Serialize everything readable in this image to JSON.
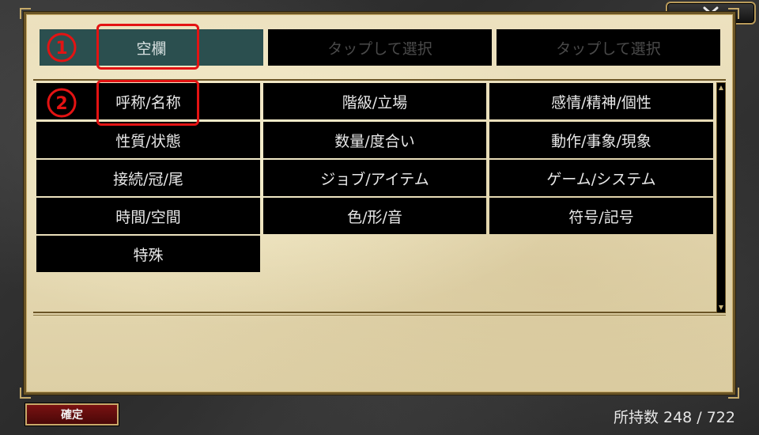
{
  "close_button": {
    "icon": "close-icon"
  },
  "slots": [
    {
      "label": "空欄",
      "active": true
    },
    {
      "label": "タップして選択",
      "active": false
    },
    {
      "label": "タップして選択",
      "active": false
    }
  ],
  "categories": [
    "呼称/名称",
    "階級/立場",
    "感情/精神/個性",
    "性質/状態",
    "数量/度合い",
    "動作/事象/現象",
    "接続/冠/尾",
    "ジョブ/アイテム",
    "ゲーム/システム",
    "時間/空間",
    "色/形/音",
    "符号/記号",
    "特殊"
  ],
  "annotations": {
    "first": "①",
    "second": "②",
    "color": "#e31313"
  },
  "confirm_button": {
    "label": "確定"
  },
  "owned_count": {
    "text": "所持数 248 / 722"
  },
  "colors": {
    "active_slot": "#2b4f4f",
    "parchment": "#e7dbb5",
    "frame": "#6b5526"
  }
}
